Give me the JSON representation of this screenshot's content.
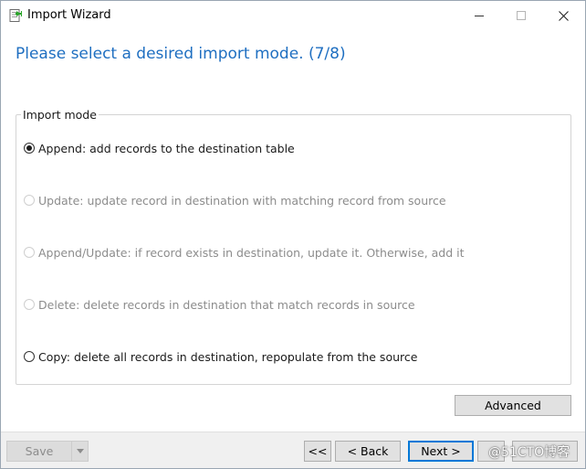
{
  "window": {
    "title": "Import Wizard",
    "icon": "import-wizard-icon",
    "controls": {
      "minimize": "minimize-icon",
      "maximize": "maximize-icon",
      "close": "close-icon"
    }
  },
  "wizard": {
    "heading": "Please select a desired import mode. (7/8)"
  },
  "import_mode": {
    "legend": "Import mode",
    "options": [
      {
        "label": "Append: add records to the destination table",
        "checked": true,
        "enabled": true
      },
      {
        "label": "Update: update record in destination with matching record from source",
        "checked": false,
        "enabled": false
      },
      {
        "label": "Append/Update: if record exists in destination, update it. Otherwise, add it",
        "checked": false,
        "enabled": false
      },
      {
        "label": "Delete: delete records in destination that match records in source",
        "checked": false,
        "enabled": false
      },
      {
        "label": "Copy: delete all records in destination, repopulate from the source",
        "checked": false,
        "enabled": true
      }
    ]
  },
  "buttons": {
    "advanced": "Advanced",
    "save": "Save",
    "first": "<<",
    "back": "< Back",
    "next": "Next >",
    "last": "",
    "finish": ""
  },
  "watermark": "@51CTO博客",
  "colors": {
    "accent": "#1f6fc1",
    "default_button_border": "#0078d7",
    "footer_bg": "#f0f0f0",
    "disabled_text": "#8c8c8c"
  }
}
